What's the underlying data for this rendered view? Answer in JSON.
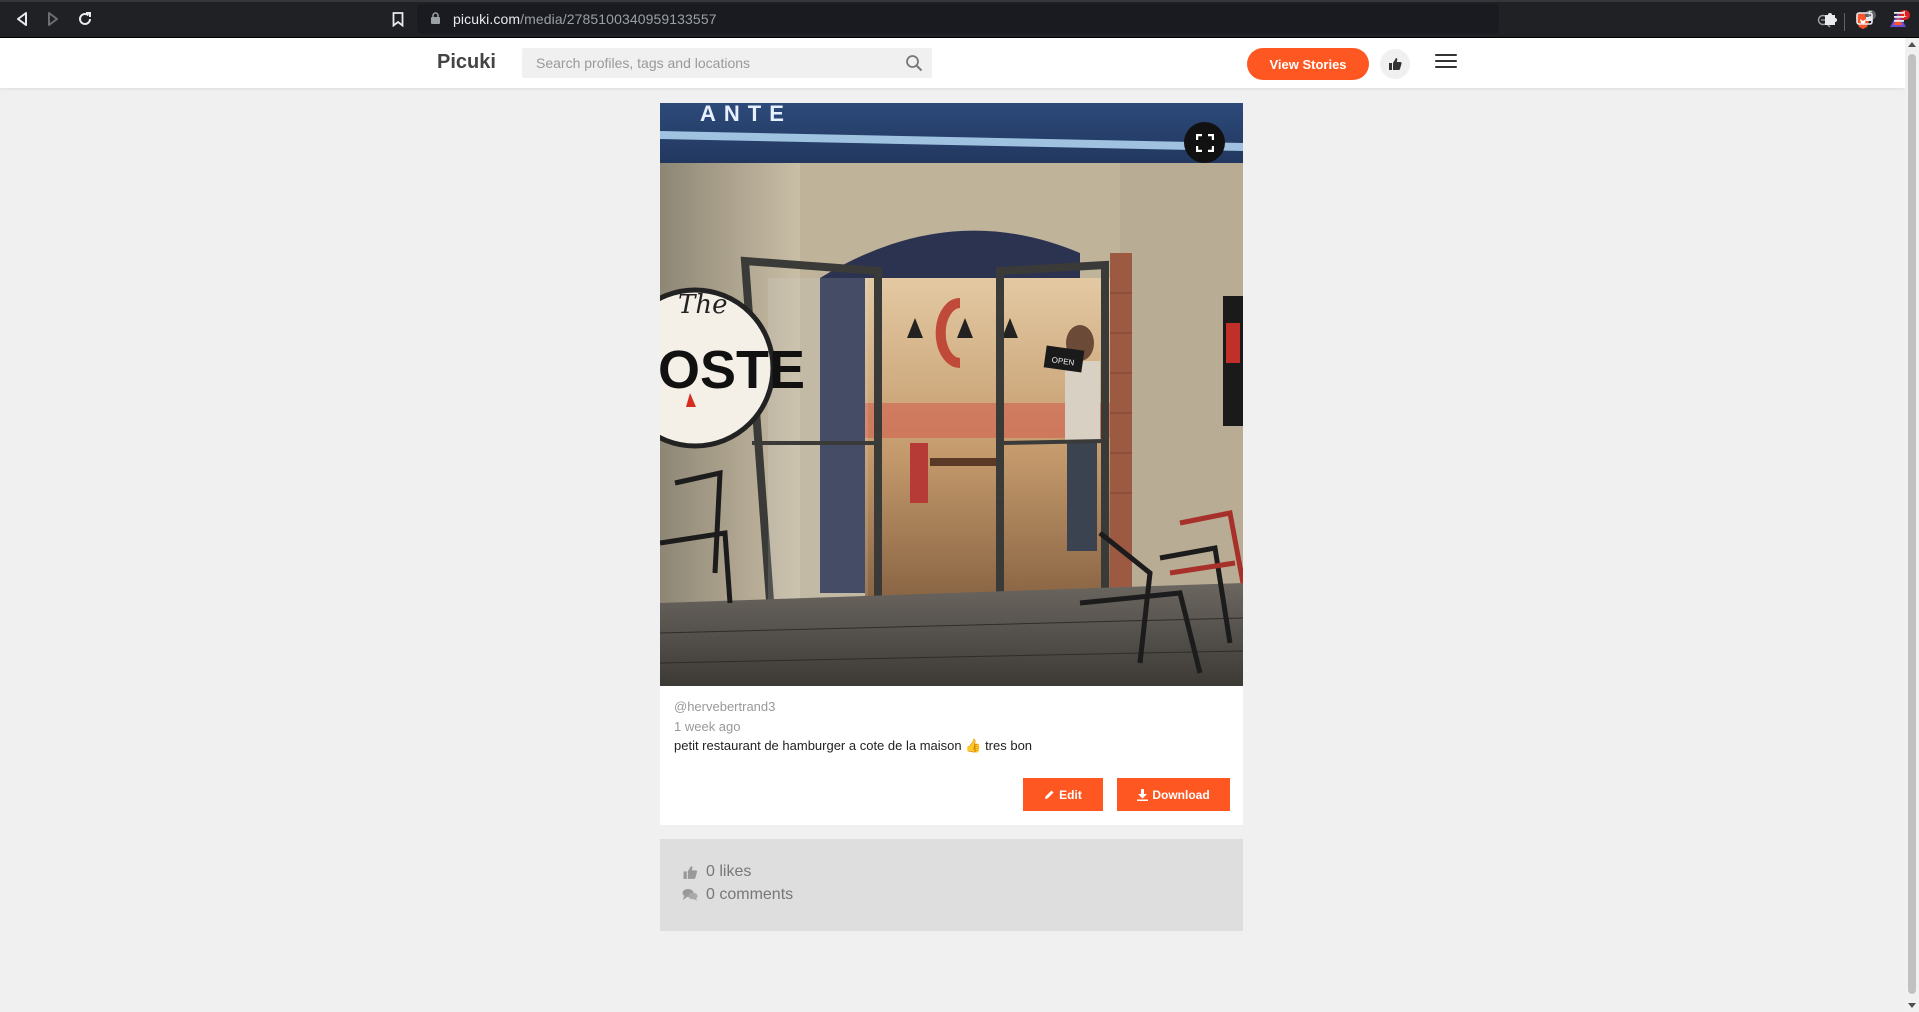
{
  "browser": {
    "url_domain": "picuki.com",
    "url_path": "/media/2785100340959133557",
    "shield_count": "5",
    "rewards_count": "1"
  },
  "header": {
    "logo": "Picuki",
    "search_placeholder": "Search profiles, tags and locations",
    "view_stories_label": "View Stories"
  },
  "post": {
    "username": "@hervebertrand3",
    "time": "1 week ago",
    "caption_before": "petit restaurant de hamburger a cote de la maison",
    "caption_emoji": "👍",
    "caption_after": "tres bon",
    "photo_sign_text": "OPEN",
    "edit_label": "Edit",
    "download_label": "Download"
  },
  "stats": {
    "likes": "0 likes",
    "comments": "0 comments"
  },
  "colors": {
    "accent": "#ff5722",
    "page_bg": "#f0f0f0",
    "browser_bg": "#202124"
  }
}
